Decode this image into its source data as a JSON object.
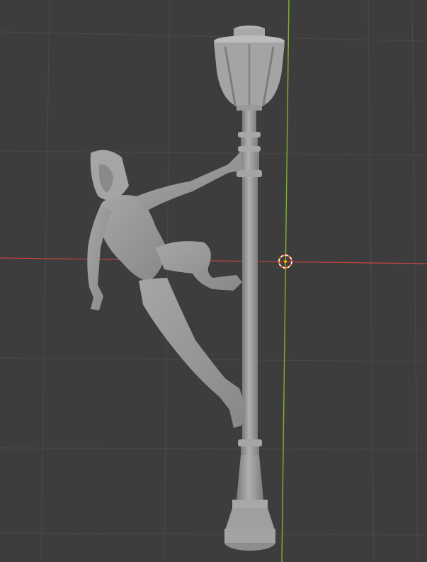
{
  "viewport": {
    "background": "#3d3d3d",
    "grid_color": "#4a4a4a",
    "x_axis_color": "#c8443f",
    "y_axis_color": "#7fb22b",
    "mesh_color": "#9c9c9c",
    "mesh_shadow": "#6f6f6f",
    "cursor_colors": [
      "#ff6a3a",
      "#ffffff"
    ]
  },
  "scene": {
    "objects": [
      "hooded-figure-mesh",
      "street-lamp-mesh"
    ],
    "cursor_icon": "3d-cursor-icon"
  }
}
